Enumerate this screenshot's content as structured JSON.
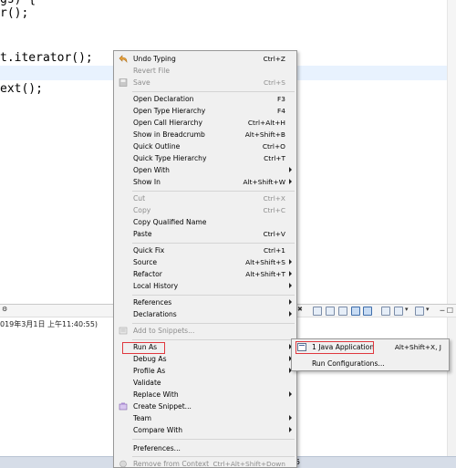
{
  "editor": {
    "lines": [
      "gs) {",
      "r();",
      "t.iterator();",
      "ext();"
    ]
  },
  "console": {
    "description": "019年3月1日 上午11:40:55)"
  },
  "status_bar": {
    "text": "5"
  },
  "context_menu": {
    "undo_typing": {
      "label": "Undo Typing",
      "shortcut": "Ctrl+Z",
      "icon": "undo-icon"
    },
    "revert_file": {
      "label": "Revert File"
    },
    "save": {
      "label": "Save",
      "shortcut": "Ctrl+S",
      "icon": "save-icon"
    },
    "open_declaration": {
      "label": "Open Declaration",
      "shortcut": "F3"
    },
    "open_type_hierarchy": {
      "label": "Open Type Hierarchy",
      "shortcut": "F4"
    },
    "open_call_hierarchy": {
      "label": "Open Call Hierarchy",
      "shortcut": "Ctrl+Alt+H"
    },
    "show_in_breadcrumb": {
      "label": "Show in Breadcrumb",
      "shortcut": "Alt+Shift+B"
    },
    "quick_outline": {
      "label": "Quick Outline",
      "shortcut": "Ctrl+O"
    },
    "quick_type_hierarchy": {
      "label": "Quick Type Hierarchy",
      "shortcut": "Ctrl+T"
    },
    "open_with": {
      "label": "Open With"
    },
    "show_in": {
      "label": "Show In",
      "shortcut": "Alt+Shift+W"
    },
    "cut": {
      "label": "Cut",
      "shortcut": "Ctrl+X"
    },
    "copy": {
      "label": "Copy",
      "shortcut": "Ctrl+C"
    },
    "copy_qualified_name": {
      "label": "Copy Qualified Name"
    },
    "paste": {
      "label": "Paste",
      "shortcut": "Ctrl+V"
    },
    "quick_fix": {
      "label": "Quick Fix",
      "shortcut": "Ctrl+1"
    },
    "source": {
      "label": "Source",
      "shortcut": "Alt+Shift+S"
    },
    "refactor": {
      "label": "Refactor",
      "shortcut": "Alt+Shift+T"
    },
    "local_history": {
      "label": "Local History"
    },
    "references": {
      "label": "References"
    },
    "declarations": {
      "label": "Declarations"
    },
    "add_to_snippets": {
      "label": "Add to Snippets...",
      "icon": "snippet-icon"
    },
    "run_as": {
      "label": "Run As"
    },
    "debug_as": {
      "label": "Debug As"
    },
    "profile_as": {
      "label": "Profile As"
    },
    "validate": {
      "label": "Validate"
    },
    "replace_with": {
      "label": "Replace With"
    },
    "create_snippet": {
      "label": "Create Snippet...",
      "icon": "create-snippet-icon"
    },
    "team": {
      "label": "Team"
    },
    "compare_with": {
      "label": "Compare With"
    },
    "preferences": {
      "label": "Preferences..."
    },
    "remove_from_context": {
      "label": "Remove from Context",
      "shortcut": "Ctrl+Alt+Shift+Down",
      "icon": "remove-context-icon"
    }
  },
  "submenu_run_as": {
    "java_application": {
      "label": "1 Java Application",
      "shortcut": "Alt+Shift+X, J",
      "icon": "java-application-icon"
    },
    "run_configurations": {
      "label": "Run Configurations..."
    }
  },
  "colors": {
    "menu_background": "#f0f0f0",
    "menu_highlight": "#d5e4f5",
    "annotation_box": "#e0383e",
    "current_line": "#e8f2fe",
    "status_bar": "#d6dde8"
  }
}
